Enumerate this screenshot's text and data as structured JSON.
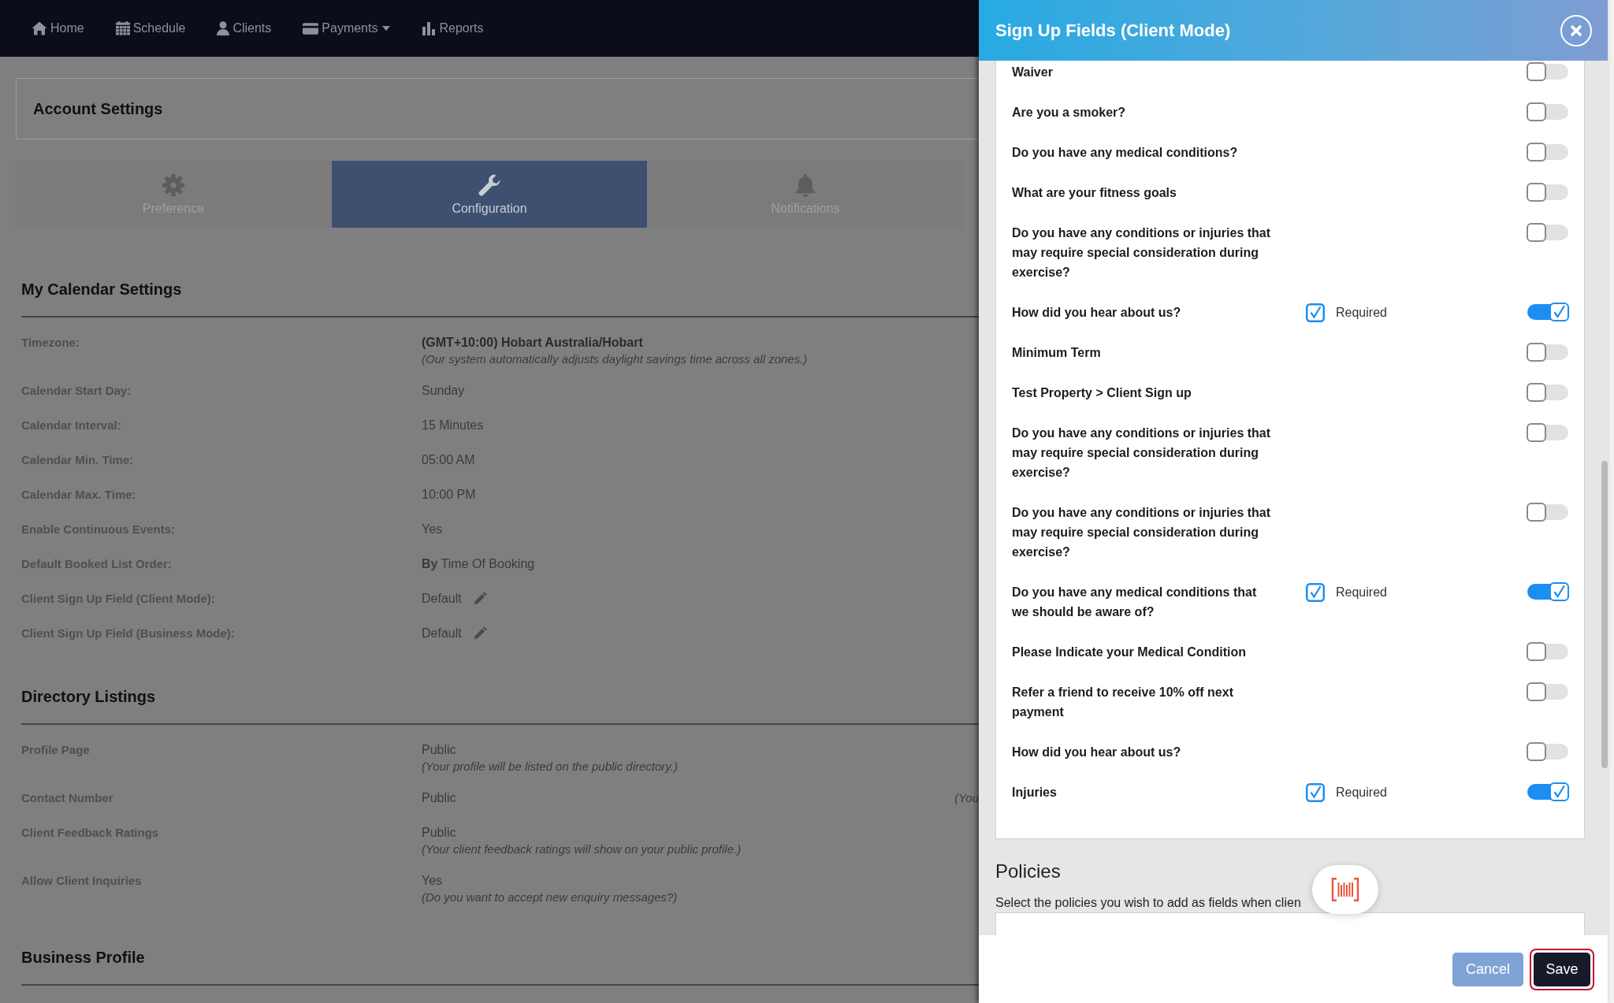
{
  "navbar": {
    "items": [
      {
        "label": "Home",
        "dropdown": false
      },
      {
        "label": "Schedule",
        "dropdown": false
      },
      {
        "label": "Clients",
        "dropdown": false
      },
      {
        "label": "Payments",
        "dropdown": true
      },
      {
        "label": "Reports",
        "dropdown": false
      }
    ]
  },
  "page_header": {
    "title": "Account Settings"
  },
  "tabs": [
    {
      "label": "Preference",
      "selected": false
    },
    {
      "label": "Configuration",
      "selected": true
    },
    {
      "label": "Notifications",
      "selected": false
    }
  ],
  "sections": [
    {
      "title": "My Calendar Settings",
      "rows": [
        {
          "label": "Timezone:",
          "value": "(GMT+10:00) Hobart Australia/Hobart",
          "strong": true,
          "editable": false,
          "note": "(Our system automatically adjusts daylight savings time across all zones.)"
        },
        {
          "label": "Calendar Start Day:",
          "value": "Sunday",
          "strong": false,
          "editable": false
        },
        {
          "label": "Calendar Interval:",
          "value": "15 Minutes",
          "strong": false,
          "editable": false
        },
        {
          "label": "Calendar Min. Time:",
          "value": "05:00 AM",
          "strong": false,
          "editable": false
        },
        {
          "label": "Calendar Max. Time:",
          "value": "10:00 PM",
          "strong": false,
          "editable": false
        },
        {
          "label": "Enable Continuous Events:",
          "value": "Yes",
          "strong": false,
          "editable": false
        },
        {
          "label": "Default Booked List Order:",
          "value": "**By** Time Of Booking",
          "strong": false,
          "editable": false
        },
        {
          "label": "Client Sign Up Field (Client Mode):",
          "value": "Default",
          "strong": false,
          "editable": true
        },
        {
          "label": "Client Sign Up Field (Business Mode):",
          "value": "Default",
          "strong": false,
          "editable": true
        }
      ]
    },
    {
      "title": "Directory Listings",
      "rows": [
        {
          "label": "Profile Page",
          "value": "Public",
          "strong": false,
          "editable": false,
          "note": "(Your profile will be listed on the public directory.)"
        },
        {
          "label": "Contact Number",
          "value": "Public",
          "strong": false,
          "editable": false,
          "side_note": "(You"
        },
        {
          "label": "Client Feedback Ratings",
          "value": "Public",
          "strong": false,
          "editable": false,
          "note": "(Your client feedback ratings will show on your public profile.)"
        },
        {
          "label": "Allow Client Inquiries",
          "value": "Yes",
          "strong": false,
          "editable": false,
          "note": "(Do you want to accept new enquiry messages?)"
        }
      ]
    },
    {
      "title": "Business Profile"
    }
  ],
  "drawer": {
    "title": "Sign Up Fields (Client Mode)",
    "fields": [
      {
        "label": "Waiver",
        "on": false
      },
      {
        "label": "Are you a smoker?",
        "on": false
      },
      {
        "label": "Do you have any medical conditions?",
        "on": false
      },
      {
        "label": "What are your fitness goals",
        "on": false
      },
      {
        "label": "Do you have any conditions or injuries that may require special consideration during exercise?",
        "on": false
      },
      {
        "label": "How did you hear about us?",
        "on": true,
        "required": {
          "checked": true,
          "label": "Required"
        }
      },
      {
        "label": "Minimum Term",
        "on": false
      },
      {
        "label": "Test Property > Client Sign up",
        "on": false
      },
      {
        "label": "Do you have any conditions or injuries that may require special consideration during exercise?",
        "on": false
      },
      {
        "label": "Do you have any conditions or injuries that may require special consideration during exercise?",
        "on": false
      },
      {
        "label": "Do you have any medical conditions that we should be aware of?",
        "on": true,
        "required": {
          "checked": true,
          "label": "Required"
        }
      },
      {
        "label": "Please Indicate your Medical Condition",
        "on": false
      },
      {
        "label": "Refer a friend to receive 10% off next payment",
        "on": false
      },
      {
        "label": "How did you hear about us?",
        "on": false
      },
      {
        "label": "Injuries",
        "on": true,
        "required": {
          "checked": true,
          "label": "Required"
        }
      }
    ],
    "policies": {
      "title": "Policies",
      "description": "Select the policies you wish to add as fields when clien"
    },
    "buttons": [
      {
        "label": "Cancel",
        "kind": "secondary",
        "focused": false
      },
      {
        "label": "Save",
        "kind": "primary",
        "focused": true
      }
    ]
  }
}
